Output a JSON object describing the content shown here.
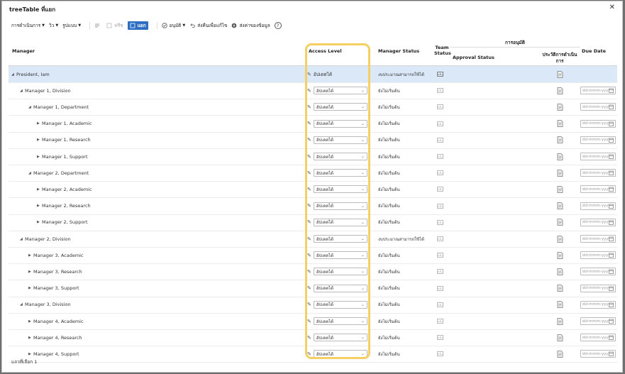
{
  "window": {
    "title": "treeTable ที่แยก",
    "close": "✕"
  },
  "toolbar": {
    "actions_label": "การดำเนินการ",
    "view_label": "วิว",
    "format_label": "รูปแบบ",
    "freeze_label": "ฟรีซ",
    "detach_label": "แยก",
    "approve_label": "อนุมัติ",
    "sendback_label": "ส่งคืนเพื่อแก้ไข",
    "senddata_label": "ส่งค่าของข้อมูล",
    "help": "?"
  },
  "columns": {
    "manager": "Manager",
    "access": "Access Level",
    "manager_status": "Manager Status",
    "team_status": "Team Status",
    "approval_group": "การอนุมัติ",
    "approval_status": "Approval Status",
    "history": "ประวัติการดำเนินการ",
    "due": "Due Date"
  },
  "date_placeholder": "dd-mmm-yyy",
  "rows": [
    {
      "name": "President, Iam",
      "level": 0,
      "expanded": true,
      "access": "อัปเดตได้",
      "dropdown": false,
      "status": "งบประมาณสามารถใช้ได้",
      "selected": true,
      "history": true,
      "due": false
    },
    {
      "name": "Manager 1, Division",
      "level": 1,
      "expanded": true,
      "access": "อัปเดตได้",
      "dropdown": true,
      "status": "ยังไม่เริ่มต้น",
      "selected": false,
      "history": true,
      "due": true
    },
    {
      "name": "Manager 1, Department",
      "level": 2,
      "expanded": true,
      "access": "อัปเดตได้",
      "dropdown": true,
      "status": "ยังไม่เริ่มต้น",
      "selected": false,
      "history": true,
      "due": true
    },
    {
      "name": "Manager 1, Academic",
      "level": 3,
      "expanded": false,
      "access": "อัปเดตได้",
      "dropdown": true,
      "status": "ยังไม่เริ่มต้น",
      "selected": false,
      "history": true,
      "due": true
    },
    {
      "name": "Manager 1, Research",
      "level": 3,
      "expanded": false,
      "access": "อัปเดตได้",
      "dropdown": true,
      "status": "ยังไม่เริ่มต้น",
      "selected": false,
      "history": true,
      "due": true
    },
    {
      "name": "Manager 1, Support",
      "level": 3,
      "expanded": false,
      "access": "อัปเดตได้",
      "dropdown": true,
      "status": "ยังไม่เริ่มต้น",
      "selected": false,
      "history": true,
      "due": true
    },
    {
      "name": "Manager 2, Department",
      "level": 2,
      "expanded": true,
      "access": "อัปเดตได้",
      "dropdown": true,
      "status": "ยังไม่เริ่มต้น",
      "selected": false,
      "history": true,
      "due": true
    },
    {
      "name": "Manager 2, Academic",
      "level": 3,
      "expanded": false,
      "access": "อัปเดตได้",
      "dropdown": true,
      "status": "ยังไม่เริ่มต้น",
      "selected": false,
      "history": true,
      "due": true
    },
    {
      "name": "Manager 2, Research",
      "level": 3,
      "expanded": false,
      "access": "อัปเดตได้",
      "dropdown": true,
      "status": "ยังไม่เริ่มต้น",
      "selected": false,
      "history": true,
      "due": true
    },
    {
      "name": "Manager 2, Support",
      "level": 3,
      "expanded": false,
      "access": "อัปเดตได้",
      "dropdown": true,
      "status": "ยังไม่เริ่มต้น",
      "selected": false,
      "history": true,
      "due": true
    },
    {
      "name": "Manager 2, Division",
      "level": 1,
      "expanded": true,
      "access": "อัปเดตได้",
      "dropdown": true,
      "status": "งบประมาณสามารถใช้ได้",
      "selected": false,
      "history": true,
      "due": true
    },
    {
      "name": "Manager 3, Academic",
      "level": 2,
      "expanded": false,
      "access": "อัปเดตได้",
      "dropdown": true,
      "status": "ยังไม่เริ่มต้น",
      "selected": false,
      "history": true,
      "due": true
    },
    {
      "name": "Manager 3, Research",
      "level": 2,
      "expanded": false,
      "access": "อัปเดตได้",
      "dropdown": true,
      "status": "ยังไม่เริ่มต้น",
      "selected": false,
      "history": true,
      "due": true
    },
    {
      "name": "Manager 3, Support",
      "level": 2,
      "expanded": false,
      "access": "อัปเดตได้",
      "dropdown": true,
      "status": "ยังไม่เริ่มต้น",
      "selected": false,
      "history": true,
      "due": true
    },
    {
      "name": "Manager 3, Division",
      "level": 1,
      "expanded": true,
      "access": "อัปเดตได้",
      "dropdown": true,
      "status": "ยังไม่เริ่มต้น",
      "selected": false,
      "history": true,
      "due": true
    },
    {
      "name": "Manager 4, Academic",
      "level": 2,
      "expanded": false,
      "access": "อัปเดตได้",
      "dropdown": true,
      "status": "ยังไม่เริ่มต้น",
      "selected": false,
      "history": true,
      "due": true
    },
    {
      "name": "Manager 4, Research",
      "level": 2,
      "expanded": false,
      "access": "อัปเดตได้",
      "dropdown": true,
      "status": "ยังไม่เริ่มต้น",
      "selected": false,
      "history": true,
      "due": true
    },
    {
      "name": "Manager 4, Support",
      "level": 2,
      "expanded": false,
      "access": "อัปเดตได้",
      "dropdown": true,
      "status": "ยังไม่เริ่มต้น",
      "selected": false,
      "history": true,
      "due": true
    }
  ],
  "footer": {
    "label": "แถวที่เลือก",
    "count": "1"
  }
}
